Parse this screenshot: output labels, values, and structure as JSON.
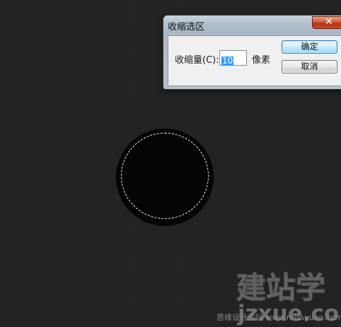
{
  "dialog": {
    "title": "收缩选区",
    "close_symbol": "✕",
    "shrink_label": "收缩量(C):",
    "shrink_value": "10",
    "unit": "像素",
    "ok_label": "确定",
    "cancel_label": "取消"
  },
  "canvas": {
    "background_color": "#222222",
    "shape_color": "#050505",
    "marquee_color": "#f0f0f0"
  },
  "watermark": {
    "logo_text": "建站学",
    "logo_subtext": "jzxue.com",
    "caption": "思缘设计论坛  www.missyuan.com"
  },
  "colors": {
    "close_button": "#c8482c",
    "selection_highlight": "#3399ff"
  }
}
